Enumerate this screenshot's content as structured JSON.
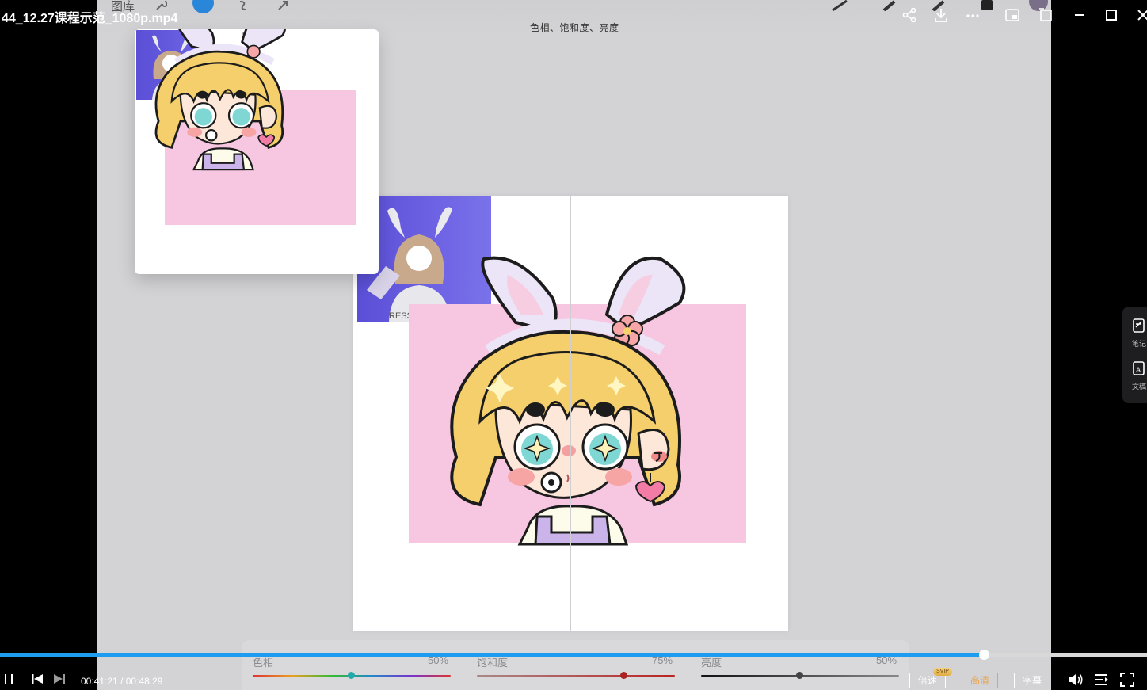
{
  "player": {
    "file_title": "44_12.27课程示范_1080p.mp4",
    "current_time": "00:41:21",
    "separator": "/",
    "total_time": "00:48:29",
    "progress": 0.858,
    "buttons": {
      "speed": "倍速",
      "speed_badge": "SVIP",
      "quality": "高清",
      "subtitles": "字幕"
    },
    "side_tools": [
      {
        "label": "笔记",
        "icon": "note-icon"
      },
      {
        "label": "文稿",
        "icon": "transcript-icon"
      }
    ],
    "accent_color": "#1e9cf0",
    "active_color": "#e9a34a"
  },
  "video": {
    "app_gallery_label": "图库",
    "app_header": "色相、饱和度、亮度",
    "adjustments": [
      {
        "label": "色相",
        "value": "50%",
        "level": 0.5
      },
      {
        "label": "饱和度",
        "value": "75%",
        "level": 0.75
      },
      {
        "label": "亮度",
        "value": "50%",
        "level": 0.5
      }
    ]
  }
}
